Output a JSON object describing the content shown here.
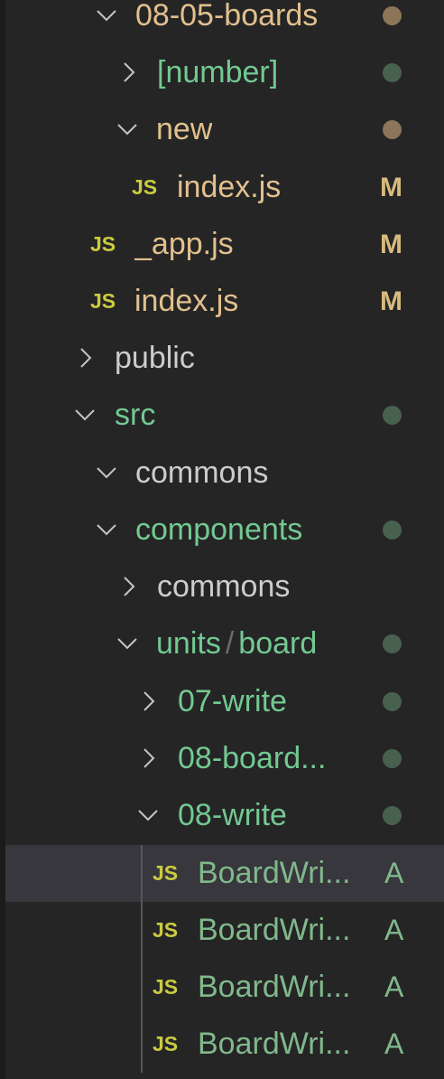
{
  "explorer": {
    "items": [
      {
        "label": "08-05-boards",
        "kind": "folder",
        "expanded": true,
        "status": "modified-dot"
      },
      {
        "label": "[number]",
        "kind": "folder",
        "expanded": false,
        "status": "untracked-dot"
      },
      {
        "label": "new",
        "kind": "folder",
        "expanded": true,
        "status": "modified-dot"
      },
      {
        "icon": "JS",
        "label": "index.js",
        "kind": "file",
        "status": "M"
      },
      {
        "icon": "JS",
        "label": "_app.js",
        "kind": "file",
        "status": "M"
      },
      {
        "icon": "JS",
        "label": "index.js",
        "kind": "file",
        "status": "M"
      },
      {
        "label": "public",
        "kind": "folder",
        "expanded": false
      },
      {
        "label": "src",
        "kind": "folder",
        "expanded": true,
        "status": "untracked-dot"
      },
      {
        "label": "commons",
        "kind": "folder",
        "expanded": true
      },
      {
        "label": "components",
        "kind": "folder",
        "expanded": true,
        "status": "untracked-dot"
      },
      {
        "label": "commons",
        "kind": "folder",
        "expanded": false
      },
      {
        "label": "units",
        "label2": "board",
        "separator": "/",
        "kind": "folder",
        "expanded": true,
        "status": "untracked-dot"
      },
      {
        "label": "07-write",
        "kind": "folder",
        "expanded": false,
        "status": "untracked-dot"
      },
      {
        "label": "08-board...",
        "kind": "folder",
        "expanded": false,
        "status": "untracked-dot"
      },
      {
        "label": "08-write",
        "kind": "folder",
        "expanded": true,
        "status": "untracked-dot"
      },
      {
        "icon": "JS",
        "label": "BoardWri...",
        "kind": "file",
        "status": "A",
        "selected": true
      },
      {
        "icon": "JS",
        "label": "BoardWri...",
        "kind": "file",
        "status": "A"
      },
      {
        "icon": "JS",
        "label": "BoardWri...",
        "kind": "file",
        "status": "A"
      },
      {
        "icon": "JS",
        "label": "BoardWri...",
        "kind": "file",
        "status": "A"
      }
    ]
  },
  "colors": {
    "background": "#252526",
    "modified": "#e2c08d",
    "untracked": "#73c991",
    "added": "#81b88b",
    "js_icon": "#cbcb41",
    "selection": "#37373d"
  },
  "icons": {
    "collapsed": "chevron-right-icon",
    "expanded": "chevron-down-icon",
    "file": "javascript-file-icon"
  }
}
